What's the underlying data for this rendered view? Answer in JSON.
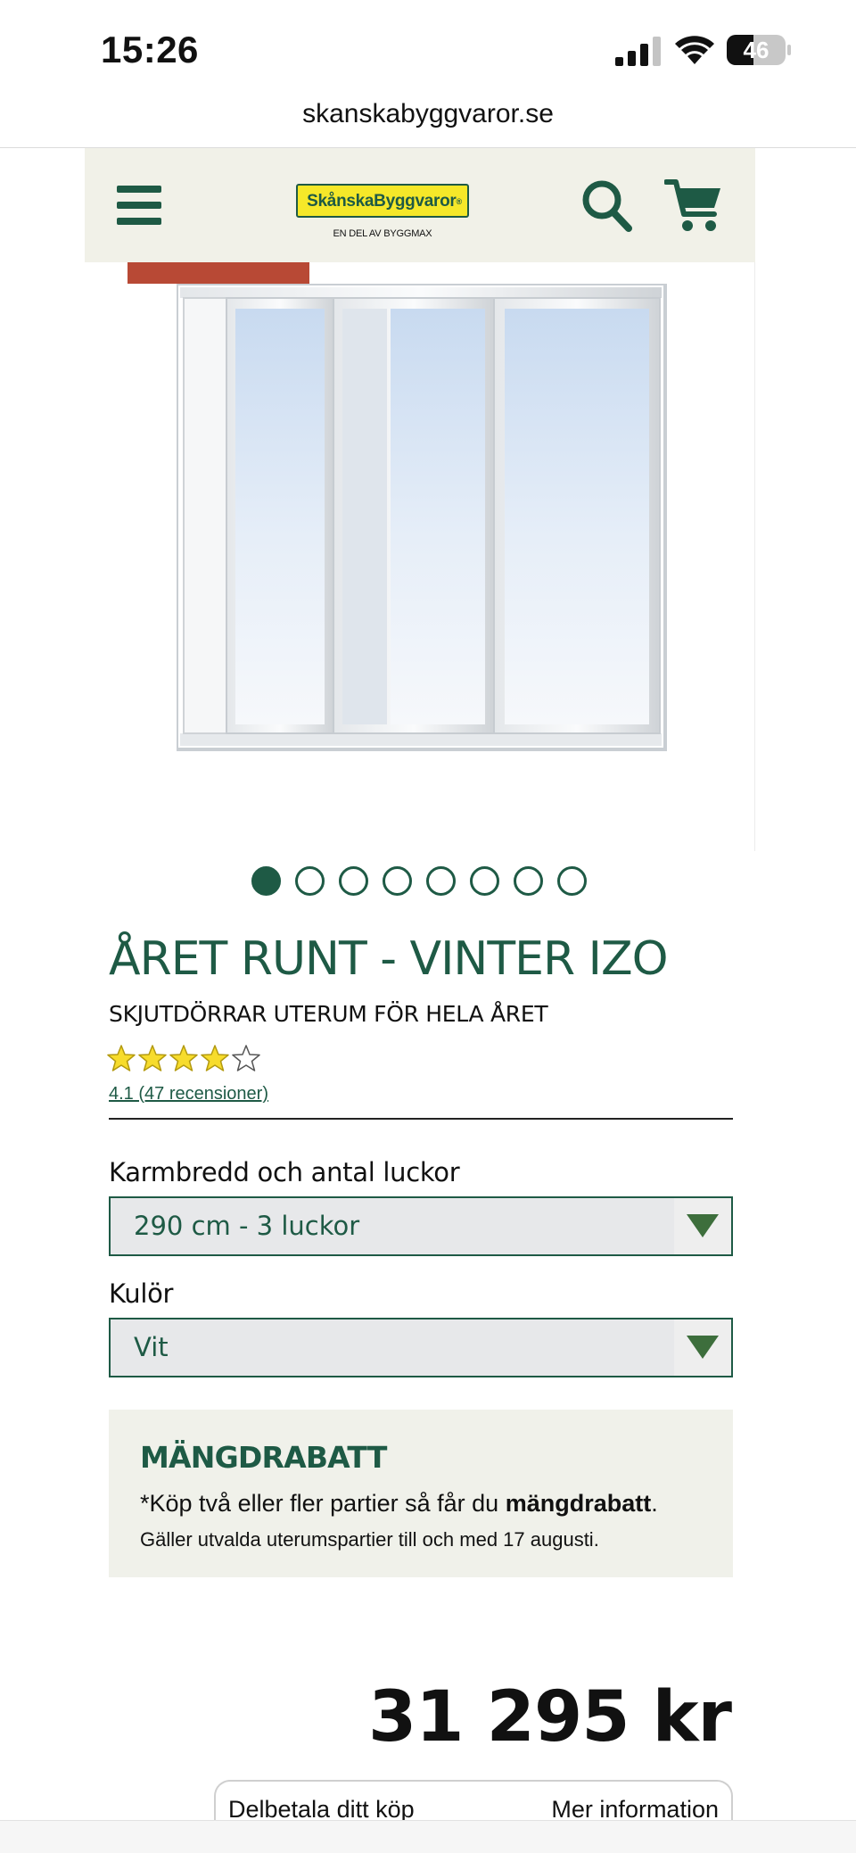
{
  "status_bar": {
    "time": "15:26",
    "battery_level": "46",
    "battery_fraction": 0.46,
    "icons": [
      "signal-icon",
      "wifi-icon",
      "battery-icon"
    ]
  },
  "browser": {
    "url": "skanskabyggvaror.se"
  },
  "header": {
    "logo_text": "SkånskaByggvaror",
    "logo_registered": "®",
    "logo_subtext": "EN DEL AV BYGGMAX",
    "icons": [
      "menu-icon",
      "search-icon",
      "cart-icon"
    ]
  },
  "gallery": {
    "dot_count": 8,
    "active_index": 0
  },
  "product": {
    "title": "ÅRET RUNT - VINTER IZO",
    "subtitle": "SKJUTDÖRRAR UTERUM FÖR HELA ÅRET",
    "rating": 4.1,
    "rating_max": 5,
    "reviews_text": "4.1 (47 recensioner)"
  },
  "options": {
    "size_label": "Karmbredd och antal luckor",
    "size_value": "290 cm - 3 luckor",
    "color_label": "Kulör",
    "color_value": "Vit"
  },
  "discount": {
    "title": "MÄNGDRABATT",
    "line1_prefix": "*Köp två eller fler partier så får du ",
    "line1_bold": "mängdrabatt",
    "line1_suffix": ".",
    "line2": "Gäller utvalda uterumspartier till och med 17 augusti."
  },
  "price": "31 295 kr",
  "payment": {
    "left_text": "Delbetala ditt köp",
    "right_text": "Mer information"
  },
  "colors": {
    "brand_green": "#1e5a45",
    "brand_yellow": "#f5e829",
    "header_bg": "#f1f1e8",
    "badge_red": "#b84935",
    "star_yellow": "#f7dc2c"
  }
}
